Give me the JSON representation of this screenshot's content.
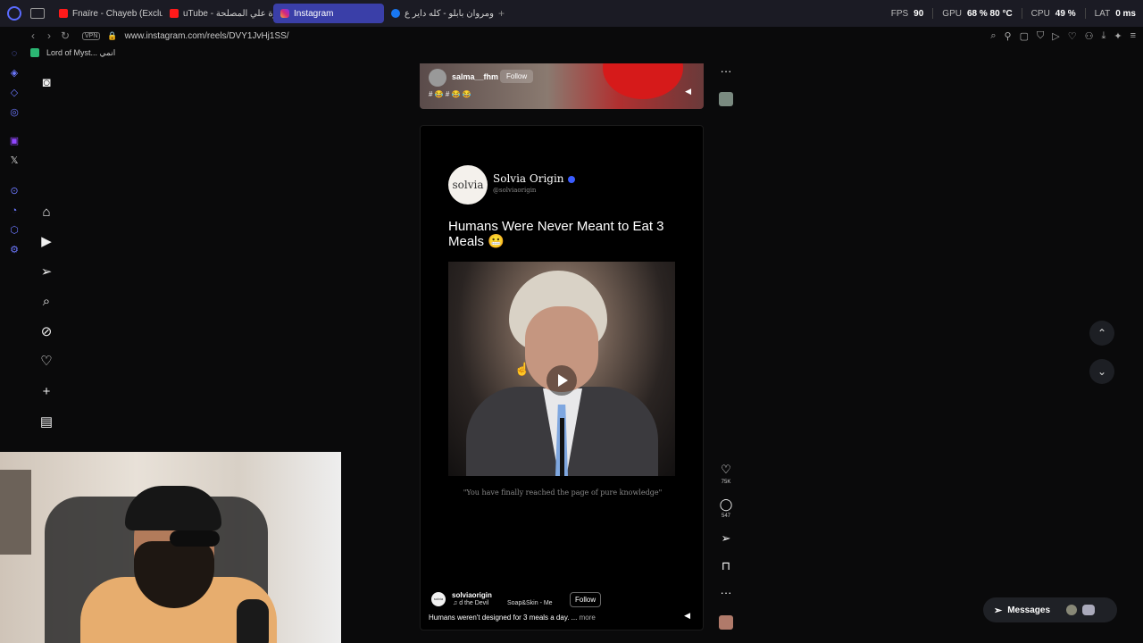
{
  "browser": {
    "tabs": [
      {
        "label": "Fnaïre - Chayeb (Exclusive",
        "icon": "youtube"
      },
      {
        "label": "uTube - دايرة علي المصلحة",
        "icon": "youtube"
      },
      {
        "label": "Instagram",
        "icon": "instagram",
        "active": true
      },
      {
        "label": "ويجز ومروان بابلو - كله داير ع...",
        "icon": "facebook"
      }
    ],
    "new_tab": "+",
    "stats": {
      "fps_label": "FPS",
      "fps": "90",
      "gpu_label": "GPU",
      "gpu": "68 % 80 °C",
      "cpu_label": "CPU",
      "cpu": "49 %",
      "lat_label": "LAT",
      "lat": "0 ms"
    },
    "vpn": "VPN",
    "url": "www.instagram.com/reels/DVY1JvHj1SS/",
    "bookmark": "Lord of Myst... انمي"
  },
  "feed": {
    "prev_post": {
      "username": "salma__fhm",
      "follow": "Follow",
      "caption": "# 😂 # 😂 😂"
    },
    "reel": {
      "logo": "solvia",
      "name": "Solvia Origin",
      "handle": "@solviaorigin",
      "headline": "Humans Were Never Meant to Eat 3 Meals 😬",
      "quote": "\"You have finally reached the page of pure knowledge\"",
      "username": "solviaorigin",
      "audio": "d the Devil",
      "audio2": "Soap&Skin - Me",
      "follow": "Follow",
      "caption": "Humans weren't designed for 3 meals a day. ...",
      "more": "more"
    },
    "likes": "75K",
    "comments": "547"
  },
  "messages": {
    "label": "Messages"
  },
  "colors": {
    "accent": "#3a3fa8",
    "verified": "#3a5cff",
    "background": "#0a0a0b"
  }
}
